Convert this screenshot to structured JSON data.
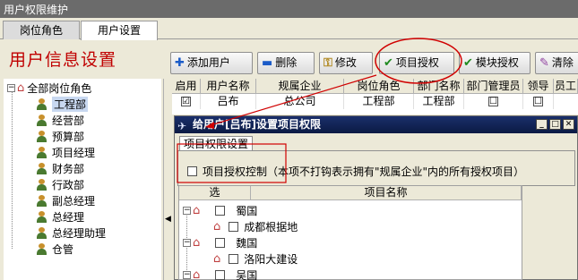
{
  "window": {
    "title": "用户权限维护"
  },
  "tabs": [
    {
      "label": "岗位角色"
    },
    {
      "label": "用户设置"
    }
  ],
  "page": {
    "heading": "用户信息设置"
  },
  "toolbar": {
    "add_user": "添加用户",
    "delete": "删除",
    "edit": "修改",
    "project_auth": "项目授权",
    "module_auth": "模块授权",
    "clear": "清除"
  },
  "tree": {
    "root": "全部岗位角色",
    "items": [
      "工程部",
      "经营部",
      "预算部",
      "项目经理",
      "财务部",
      "行政部",
      "副总经理",
      "总经理",
      "总经理助理",
      "仓管"
    ],
    "selected": "工程部"
  },
  "grid": {
    "columns": [
      "启用",
      "用户名称",
      "规属企业",
      "岗位角色",
      "部门名称",
      "部门管理员",
      "领导",
      "员工"
    ],
    "rows": [
      {
        "enabled": "☑",
        "name": "吕布",
        "company": "总公司",
        "role": "工程部",
        "dept": "工程部",
        "dept_admin": "☐",
        "leader": "☐"
      }
    ]
  },
  "dialog": {
    "title": "给用户[吕布]设置项目权限",
    "tab": "项目权限设置",
    "control_label": "项目授权控制（本项不打钩表示拥有\"规属企业\"内的所有授权项目）",
    "columns": [
      "选",
      "项目名称"
    ],
    "projects": [
      {
        "name": "蜀国",
        "level": 0
      },
      {
        "name": "成都根据地",
        "level": 1
      },
      {
        "name": "魏国",
        "level": 0
      },
      {
        "name": "洛阳大建设",
        "level": 1
      },
      {
        "name": "吴国",
        "level": 0
      }
    ]
  },
  "colors": {
    "heading": "#c00000",
    "highlight_ellipse": "#d00000",
    "dialog_titlebar": "#0b1a44"
  }
}
